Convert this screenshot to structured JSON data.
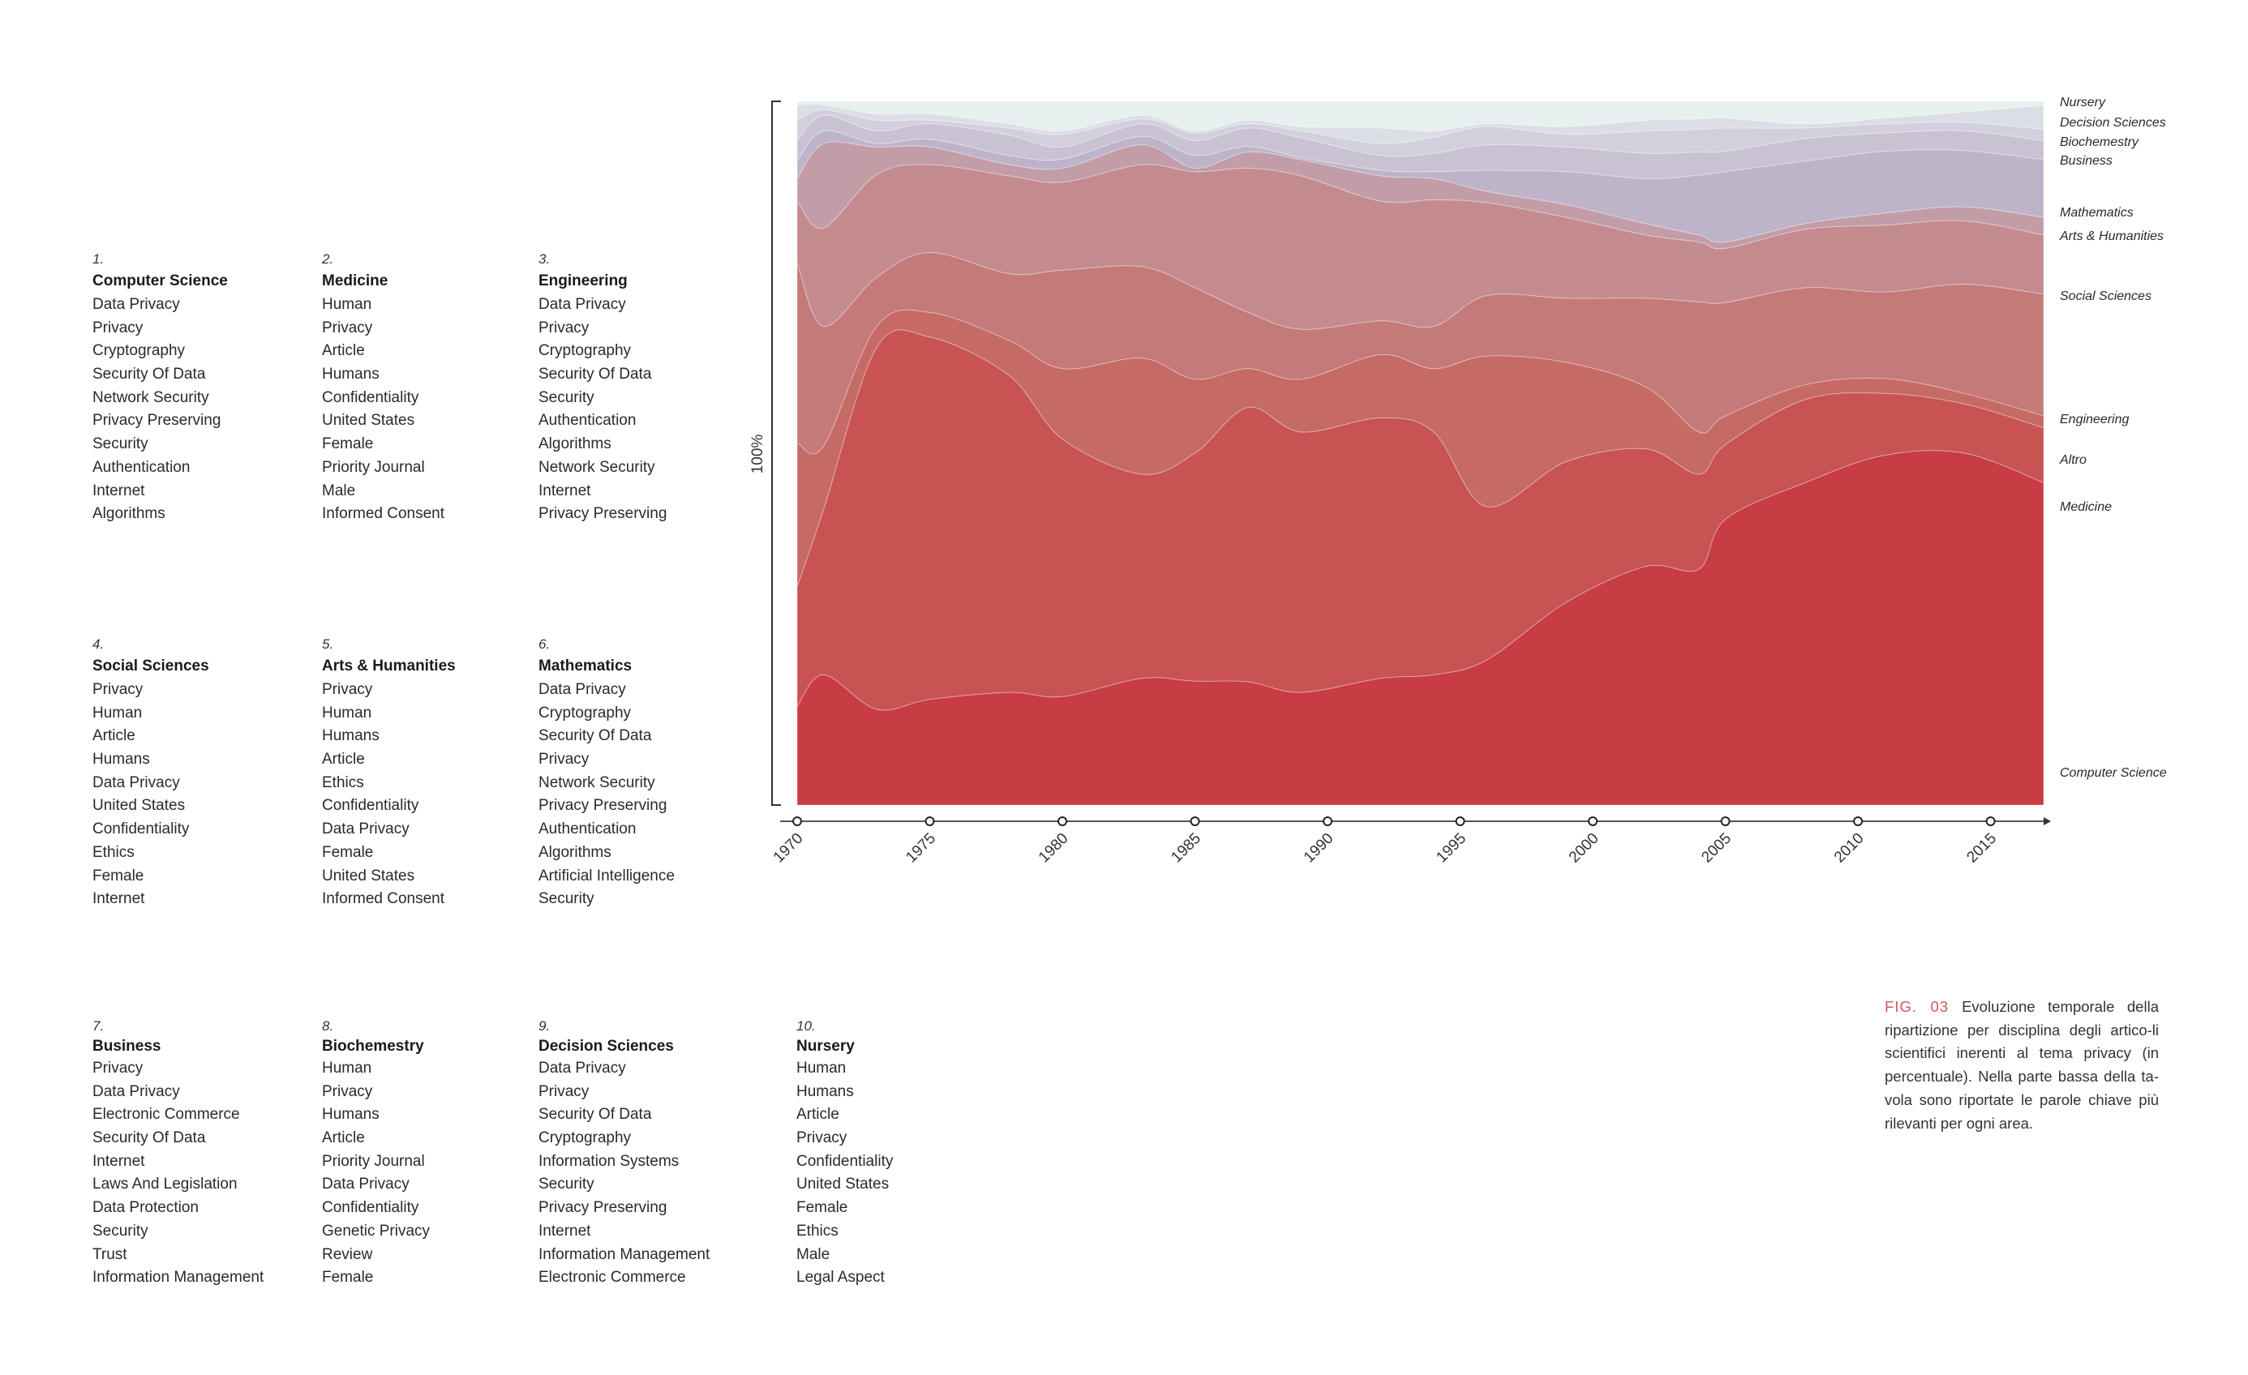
{
  "keyword_groups": [
    {
      "num": "1.",
      "title": "Computer Science",
      "keywords": [
        "Data Privacy",
        "Privacy",
        "Cryptography",
        "Security Of Data",
        "Network Security",
        "Privacy Preserving",
        "Security",
        "Authentication",
        "Internet",
        "Algorithms"
      ]
    },
    {
      "num": "2.",
      "title": "Medicine",
      "keywords": [
        "Human",
        "Privacy",
        "Article",
        "Humans",
        "Confidentiality",
        "United States",
        "Female",
        "Priority Journal",
        "Male",
        "Informed Consent"
      ]
    },
    {
      "num": "3.",
      "title": "Engineering",
      "keywords": [
        "Data Privacy",
        "Privacy",
        "Cryptography",
        "Security Of Data",
        "Security",
        "Authentication",
        "Algorithms",
        "Network Security",
        "Internet",
        "Privacy Preserving"
      ]
    },
    {
      "num": "4.",
      "title": "Social Sciences",
      "keywords": [
        "Privacy",
        "Human",
        "Article",
        "Humans",
        "Data Privacy",
        "United States",
        "Confidentiality",
        "Ethics",
        "Female",
        "Internet"
      ]
    },
    {
      "num": "5.",
      "title": "Arts & Humanities",
      "keywords": [
        "Privacy",
        "Human",
        "Humans",
        "Article",
        "Ethics",
        "Confidentiality",
        "Data Privacy",
        "Female",
        "United States",
        "Informed Consent"
      ]
    },
    {
      "num": "6.",
      "title": "Mathematics",
      "keywords": [
        "Data Privacy",
        "Cryptography",
        "Security Of Data",
        "Privacy",
        "Network Security",
        "Privacy Preserving",
        "Authentication",
        "Algorithms",
        "Artificial Intelligence",
        "Security"
      ]
    },
    {
      "num": "7.",
      "title": "Business",
      "keywords": [
        "Privacy",
        "Data Privacy",
        "Electronic Commerce",
        "Security Of Data",
        "Internet",
        "Laws And Legislation",
        "Data Protection",
        "Security",
        "Trust",
        "Information Management"
      ]
    },
    {
      "num": "8.",
      "title": "Biochemestry",
      "keywords": [
        "Human",
        "Privacy",
        "Humans",
        "Article",
        "Priority Journal",
        "Data Privacy",
        "Confidentiality",
        "Genetic Privacy",
        "Review",
        "Female"
      ]
    },
    {
      "num": "9.",
      "title": "Decision Sciences",
      "keywords": [
        "Data Privacy",
        "Privacy",
        "Security Of Data",
        "Cryptography",
        "Information Systems",
        "Security",
        "Privacy Preserving",
        "Internet",
        "Information Management",
        "Electronic Commerce"
      ]
    },
    {
      "num": "10.",
      "title": "Nursery",
      "keywords": [
        "Human",
        "Humans",
        "Article",
        "Privacy",
        "Confidentiality",
        "United States",
        "Female",
        "Ethics",
        "Male",
        "Legal Aspect"
      ]
    }
  ],
  "caption": {
    "fig_label": "FIG. 03",
    "text": "Evoluzione temporale della ripartizione per disciplina degli artico-li scientifici inerenti al tema privacy (in percentuale). Nella parte bassa della ta-vola sono riportate le parole chiave più rilevanti per ogni area."
  },
  "chart_data": {
    "type": "area",
    "stacked": true,
    "normalized": true,
    "title": "",
    "xlabel": "",
    "ylabel": "100%",
    "xlim": [
      1970,
      2017
    ],
    "ylim": [
      0,
      100
    ],
    "x_ticks": [
      1970,
      1975,
      1980,
      1985,
      1990,
      1995,
      2000,
      2005,
      2010,
      2015
    ],
    "grid": false,
    "legend": "right, labels aligned with each stream",
    "x": [
      1970,
      1971,
      1973,
      1975,
      1978,
      1980,
      1983,
      1985,
      1987,
      1989,
      1992,
      1994,
      1996,
      1999,
      2002,
      2004,
      2005,
      2008,
      2011,
      2014,
      2017
    ],
    "series": [
      {
        "name": "Computer Science",
        "color": "#c83c44",
        "label_value": 4,
        "values": [
          14,
          18.5,
          13.6,
          15,
          16,
          15.4,
          18,
          17.6,
          17.5,
          16,
          18,
          18.5,
          20.6,
          28.8,
          33.9,
          33.5,
          40.6,
          45.8,
          49.7,
          50,
          45.8
        ]
      },
      {
        "name": "Medicine",
        "color": "#c75352",
        "label_value": 42,
        "values": [
          17,
          23.5,
          51.4,
          51.5,
          45,
          36.6,
          29,
          32.4,
          39,
          37,
          37,
          34.5,
          21.8,
          20,
          16.7,
          13.5,
          10.6,
          11.8,
          8.8,
          7,
          7.8
        ]
      },
      {
        "name": "Altro",
        "color": "#c66a65",
        "label_value": 49,
        "values": [
          20.5,
          9,
          3,
          3.5,
          5,
          10,
          16.5,
          10.5,
          5.5,
          7.5,
          9,
          9,
          21.4,
          14.1,
          8.8,
          6,
          4.1,
          2.1,
          2.1,
          1.5,
          1.7
        ]
      },
      {
        "name": "Engineering",
        "color": "#c47a78",
        "label_value": 55,
        "values": [
          25.5,
          17,
          7,
          8.5,
          9.5,
          14,
          13,
          13,
          8,
          7.1,
          4.8,
          6,
          8.6,
          9.1,
          12.6,
          18.5,
          16.1,
          13.8,
          12.3,
          15.5,
          17.3
        ]
      },
      {
        "name": "Social Sciences",
        "color": "#c48b8f",
        "label_value": 73,
        "values": [
          8.8,
          14,
          14.6,
          12.5,
          13.9,
          12.5,
          14.5,
          16.5,
          20.5,
          21.8,
          17,
          18,
          13.2,
          11.5,
          9,
          8.5,
          7.7,
          8.3,
          9.5,
          9,
          8.4
        ]
      },
      {
        "name": "Arts & Humanities",
        "color": "#c29da8",
        "label_value": 81,
        "values": [
          3.2,
          12,
          3.9,
          2.5,
          1.6,
          2,
          2.8,
          0.5,
          2.3,
          2.3,
          3.6,
          3,
          1.6,
          1.8,
          1.6,
          1,
          0.9,
          0.8,
          1.7,
          2,
          2.5
        ]
      },
      {
        "name": "Mathematics",
        "color": "#bdb4ca",
        "label_value": 84.5,
        "values": [
          2.5,
          1.8,
          0.5,
          1.1,
          1.3,
          1.3,
          1.2,
          1.8,
          0.8,
          0.3,
          0.8,
          1,
          3,
          4.7,
          6.4,
          8.5,
          10,
          8.9,
          8.8,
          8,
          8.2
        ]
      },
      {
        "name": "Business",
        "color": "#c9c2d3",
        "label_value": 92,
        "values": [
          2.9,
          2.2,
          1.8,
          2.2,
          2.9,
          1.7,
          1.8,
          2.1,
          2.6,
          2.8,
          2.1,
          2.6,
          3.6,
          3.5,
          3.6,
          3.3,
          2.9,
          3.2,
          2.6,
          2.8,
          2.7
        ]
      },
      {
        "name": "Biochemestry",
        "color": "#d1d0dc",
        "label_value": 95,
        "values": [
          2.9,
          0.8,
          1.5,
          0.5,
          1,
          1.8,
          0.7,
          1.1,
          0.6,
          1,
          1.7,
          2.3,
          2.6,
          1.8,
          3.2,
          3.2,
          3.3,
          1.5,
          1.3,
          1.2,
          1.6
        ]
      },
      {
        "name": "Decision Sciences",
        "color": "#dcdee5",
        "label_value": 98,
        "values": [
          2.2,
          0.7,
          0.9,
          0.9,
          0.6,
          0.5,
          0.5,
          0.3,
          0.5,
          0.6,
          2.2,
          0.9,
          0.4,
          1.1,
          1.5,
          1.5,
          1.4,
          0.6,
          0.8,
          1.5,
          3.4
        ]
      },
      {
        "name": "Nursery",
        "color": "#e6f0ef",
        "label_value": 101,
        "values": [
          0.5,
          0.5,
          1.8,
          1.8,
          3.2,
          4.2,
          2,
          4.2,
          2.7,
          3.6,
          3.8,
          4.2,
          3.2,
          3.6,
          2.7,
          2.5,
          2.4,
          3.2,
          2.4,
          1.5,
          0.6
        ]
      }
    ]
  }
}
